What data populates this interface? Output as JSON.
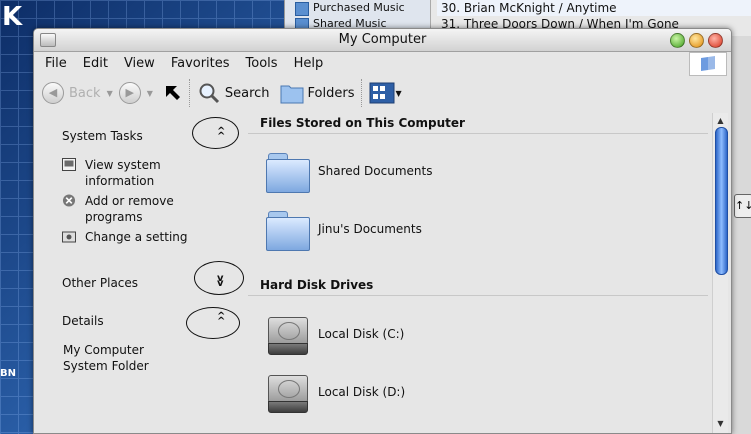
{
  "window": {
    "title": "My Computer",
    "traffic_lights": {
      "green": "#3f9d1d",
      "yellow": "#e08a0a",
      "red": "#d6321c"
    }
  },
  "background_app": {
    "sources": [
      "Purchased Music",
      "Shared Music"
    ],
    "tracks": [
      "30. Brian McKnight  / Anytime",
      "31. Three Doors Down / When I'm Gone"
    ],
    "side_button": "↑↓"
  },
  "desktop": {
    "corner_glyph": "K",
    "footer_text": "BN"
  },
  "menu": [
    "File",
    "Edit",
    "View",
    "Favorites",
    "Tools",
    "Help"
  ],
  "toolbar": {
    "back_label": "Back",
    "search_label": "Search",
    "folders_label": "Folders"
  },
  "tasks": {
    "system_tasks": {
      "title": "System Tasks",
      "items": [
        "View system information",
        "Add or remove programs",
        "Change a setting"
      ]
    },
    "other_places": {
      "title": "Other Places"
    },
    "details": {
      "title": "Details",
      "text1": "My Computer",
      "text2": "System Folder"
    }
  },
  "main": {
    "files_group": "Files Stored on This Computer",
    "files": [
      "Shared Documents",
      "Jinu's Documents"
    ],
    "disks_group": "Hard Disk Drives",
    "disks": [
      "Local Disk (C:)",
      "Local Disk (D:)"
    ]
  },
  "scrollbar": {
    "accent": "#2d66c8"
  }
}
